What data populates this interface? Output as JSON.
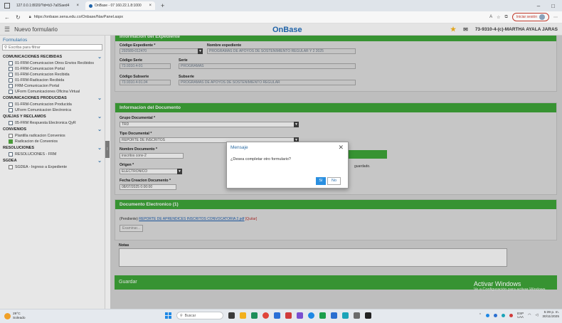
{
  "browser": {
    "tabs": [
      {
        "label": "127.0.0.1:8020/?id=b3-7a0Saed4"
      },
      {
        "label": "OnBase - 07 160.22.1.8:1000"
      }
    ],
    "new_tab": "+",
    "url": "https://onbase.sena.edu.co/Onbase/NavPanel.aspx",
    "signin_label": "Iniciar sesión",
    "minimize": "–",
    "maximize": "□"
  },
  "app": {
    "title": "Nuevo formulario",
    "logo": "OnBase",
    "user": "73-9310-4-(c)-MARTHA AYALA JARAS"
  },
  "sidebar": {
    "title": "Formularios",
    "search_placeholder": "Escriba para filtrar",
    "categories": [
      {
        "label": "COMUNICACIONES RECIBIDAS",
        "items": [
          {
            "label": "01-FRM-Comunicacion Otros Envios Recibidos",
            "icon": "form-icon"
          },
          {
            "label": "01-FRM-Comunicacion Portal",
            "icon": "form-icon"
          },
          {
            "label": "01-FRM-Comunicacion Recibida",
            "icon": "form-icon"
          },
          {
            "label": "01-FRM-Radicacion Recibida",
            "icon": "form-icon"
          },
          {
            "label": "FRM-Comunicacion Portal",
            "icon": "form-icon"
          },
          {
            "label": "UForm Comunicaciones Oficina Virtual",
            "icon": "form-icon"
          }
        ]
      },
      {
        "label": "COMUNICACIONES PRODUCIDAS",
        "items": [
          {
            "label": "01-FRM-Comunicacion Producida",
            "icon": "form-icon"
          },
          {
            "label": "UForm Comunicacion Electronica",
            "icon": "form-icon"
          }
        ]
      },
      {
        "label": "QUEJAS Y RECLAMOS",
        "items": [
          {
            "label": "05-FRM Respuesta Electronica QyR",
            "icon": "form-icon"
          }
        ]
      },
      {
        "label": "CONVENIOS",
        "items": [
          {
            "label": "Plantilla radicacion Convenios",
            "icon": "doc-icon"
          },
          {
            "label": "Radicacion de Convenios",
            "icon": "green-icon"
          }
        ]
      },
      {
        "label": "RESOLUCIONES",
        "items": [
          {
            "label": "RESOLUCIONES - FRM",
            "icon": "form-icon"
          }
        ]
      },
      {
        "label": "SGDEA",
        "items": [
          {
            "label": "SGDEA - Ingreso a Expediente",
            "icon": "doc-icon"
          }
        ]
      }
    ]
  },
  "expediente": {
    "header": "Información del Expediente",
    "codigo_expediente_label": "Código Expediente *",
    "codigo_expediente_value": "292589-012470",
    "nombre_expediente_label": "Nombre expediente",
    "nombre_expediente_value": "PROGRAMAS DE APOYOS DE SOSTENIMIENTO REGULAR Y 2 2025",
    "codigo_serie_label": "Código Serie",
    "codigo_serie_value": "73.9310.4-91",
    "serie_label": "Serie",
    "serie_value": "PROGRAMAS",
    "codigo_subserie_label": "Código Subserie",
    "codigo_subserie_value": "73.9310.4-91.04",
    "subserie_label": "Subserie",
    "subserie_value": "PROGRAMAS DE APOYOS DE SOSTENIMIENTO REGULAR"
  },
  "documento": {
    "header": "Informacion del Documento",
    "grupo_label": "Grupo Documental *",
    "grupo_value": "TRD",
    "tipo_label": "Tipo Documental *",
    "tipo_value": "REPORTE DE INSCRITOS",
    "nombre_label": "Nombre Documento *",
    "nombre_value": "inscritos conv-2",
    "origen_label": "Origen *",
    "origen_value": "ELECTRONICO",
    "fecha_label": "Fecha Creacion Documento *",
    "fecha_value": "08/07/2025 0:00:00",
    "hidden_panel_text": "guardado."
  },
  "electronico": {
    "header": "Documento Electronico (1)",
    "pending_prefix": "(Pendiente)",
    "pending_link": "REPORTE DE APRENDICES INSCRITOS CONVOCATORIA 2.pdf",
    "quitar": "[Quitar]",
    "examinar": "Examinar..."
  },
  "notas": {
    "label": "Notas"
  },
  "guardar_label": "Guardar",
  "activate": {
    "title": "Activar Windows",
    "subtitle": "Ve a Configuración para activar Windows."
  },
  "modal": {
    "title": "Mensaje",
    "body": "¿Desea completar otro formulario?",
    "yes": "Sí",
    "no": "No"
  },
  "taskbar": {
    "temp": "29°C",
    "weather": "Soleado",
    "search": "Buscar",
    "lang_top": "ESP",
    "lang_bottom": "LAA",
    "time": "5:39 p. m.",
    "date": "30/11/2025"
  }
}
